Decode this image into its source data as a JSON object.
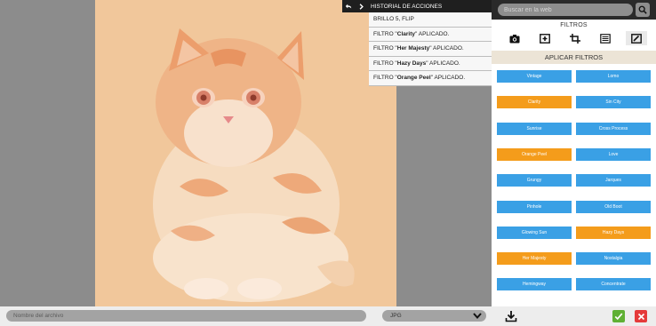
{
  "history": {
    "title": "HISTORIAL DE ACCIONES",
    "undo_icon": "undo-arrow-icon",
    "redo_icon": "chevron-right-icon",
    "items": [
      {
        "prefix": "BRILLO 5, FLIP",
        "name": "",
        "suffix": ""
      },
      {
        "prefix": "FILTRO \"",
        "name": "Clarity",
        "suffix": "\" APLICADO."
      },
      {
        "prefix": "FILTRO \"",
        "name": "Her Majesty",
        "suffix": "\" APLICADO."
      },
      {
        "prefix": "FILTRO \"",
        "name": "Hazy Days",
        "suffix": "\" APLICADO."
      },
      {
        "prefix": "FILTRO \"",
        "name": "Orange Peel",
        "suffix": "\" APLICADO."
      }
    ]
  },
  "search": {
    "placeholder": "Buscar en la web"
  },
  "tools": {
    "title": "FILTROS",
    "items": [
      "camera-icon",
      "plus-square-icon",
      "crop-icon",
      "sliders-icon",
      "draw-icon"
    ],
    "active": "draw-icon"
  },
  "filters": {
    "header": "APLICAR FILTROS",
    "items": [
      {
        "label": "Vintage",
        "active": false
      },
      {
        "label": "Lomo",
        "active": false
      },
      {
        "label": "Clarity",
        "active": true
      },
      {
        "label": "Sin City",
        "active": false
      },
      {
        "label": "Sunrise",
        "active": false
      },
      {
        "label": "Cross Process",
        "active": false
      },
      {
        "label": "Orange Peel",
        "active": true
      },
      {
        "label": "Love",
        "active": false
      },
      {
        "label": "Grungy",
        "active": false
      },
      {
        "label": "Jarques",
        "active": false
      },
      {
        "label": "Pinhole",
        "active": false
      },
      {
        "label": "Old Boot",
        "active": false
      },
      {
        "label": "Glowing Sun",
        "active": false
      },
      {
        "label": "Hazy Days",
        "active": true
      },
      {
        "label": "Her Majesty",
        "active": true
      },
      {
        "label": "Nostalgia",
        "active": false
      },
      {
        "label": "Hemingway",
        "active": false
      },
      {
        "label": "Concentrate",
        "active": false
      }
    ]
  },
  "bottom": {
    "filename_placeholder": "Nombre del archivo",
    "format_value": "JPG"
  },
  "colors": {
    "filter_default": "#3aa0e5",
    "filter_active": "#f49c1b",
    "photo_tint": "#f1c79b"
  }
}
